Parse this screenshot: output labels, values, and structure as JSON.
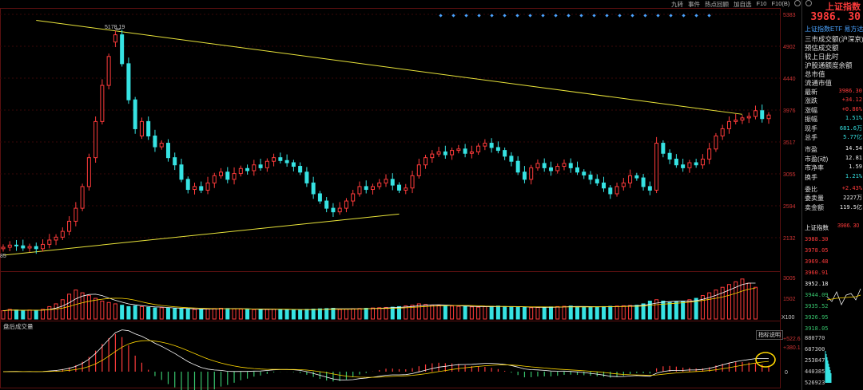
{
  "toolbar": {
    "items": [
      "九转",
      "事件",
      "热点回顾",
      "加自选",
      "F10",
      "F10(B)"
    ]
  },
  "header": {
    "index_name": "上证指数",
    "price": "3986. 30",
    "tab": "上证指数ETF 易方达"
  },
  "menu": [
    "三市成交额(沪深京)",
    "预估成交额",
    "较上日此时",
    "沪股通额度余额",
    "总市值",
    "流通市值"
  ],
  "stats": [
    {
      "k": "最新",
      "v": "3986.30",
      "c": "red"
    },
    {
      "k": "涨跌",
      "v": "+34.12",
      "c": "red"
    },
    {
      "k": "涨幅",
      "v": "+0.86%",
      "c": "red"
    },
    {
      "k": "振幅",
      "v": "1.51%",
      "c": "cyan"
    },
    {
      "k": "现手",
      "v": "681.6万",
      "c": "cyan"
    },
    {
      "k": "总手",
      "v": "5.77亿",
      "c": "cyan"
    },
    {
      "k": "市盈",
      "v": "14.54",
      "c": "white"
    },
    {
      "k": "市盈(动)",
      "v": "12.81",
      "c": "white"
    },
    {
      "k": "市净率",
      "v": "1.59",
      "c": "white"
    },
    {
      "k": "换手",
      "v": "1.21%",
      "c": "cyan"
    },
    {
      "k": "委比",
      "v": "+2.43%",
      "c": "red"
    },
    {
      "k": "委卖量",
      "v": "2227万",
      "c": "white"
    },
    {
      "k": "卖金额",
      "v": "119.5亿",
      "c": "white"
    }
  ],
  "mini": {
    "label": "上证指数",
    "value": "3986. 30"
  },
  "mini_scale": [
    "3988.30",
    "3978.05",
    "3969.48",
    "3960.91",
    "3952.18",
    "3944.09",
    "3935.52",
    "3926.95",
    "3918.05"
  ],
  "mini_volume": [
    "880770",
    "687300",
    "253847",
    "440385",
    "526923"
  ],
  "price_axis": [
    "5383",
    "4902",
    "4440",
    "3976",
    "3517",
    "3055",
    "2594",
    "2132"
  ],
  "peak_label": "5178.19",
  "low_label": "85",
  "volume_axis": [
    "3005",
    "1502",
    "X100"
  ],
  "volume_title": "盘后成交量",
  "indicator_axis": [
    "+522.6",
    "+380.1",
    "0"
  ],
  "indicator_btn": "指标说明",
  "chart_data": {
    "type": "candlestick",
    "y_axis": {
      "range": [
        2050,
        5383
      ],
      "ticks": [
        5383,
        4902,
        4440,
        3976,
        3517,
        3055,
        2594,
        2132
      ]
    },
    "annotations": [
      {
        "label": "5178.19",
        "value": 5178.19
      }
    ],
    "trendlines": [
      {
        "from": {
          "bar": 5,
          "value": 5300
        },
        "to": {
          "bar": 112,
          "value": 4000
        },
        "color": "#e8e33a"
      },
      {
        "from": {
          "bar": 0,
          "value": 2050
        },
        "to": {
          "bar": 60,
          "value": 2620
        },
        "color": "#e8e33a"
      }
    ],
    "closes": [
      2160,
      2190,
      2180,
      2150,
      2170,
      2140,
      2200,
      2260,
      2300,
      2380,
      2520,
      2700,
      3000,
      3400,
      3900,
      4400,
      4800,
      5100,
      4700,
      4200,
      3800,
      3900,
      3700,
      3550,
      3600,
      3400,
      3300,
      3100,
      2960,
      3000,
      2950,
      3050,
      3150,
      3200,
      3100,
      3180,
      3250,
      3220,
      3300,
      3260,
      3350,
      3400,
      3360,
      3330,
      3280,
      3200,
      3050,
      2900,
      2800,
      2700,
      2650,
      2700,
      2800,
      2900,
      3000,
      2960,
      3000,
      3050,
      3100,
      3020,
      2950,
      2980,
      3150,
      3300,
      3400,
      3450,
      3480,
      3440,
      3500,
      3520,
      3460,
      3480,
      3560,
      3600,
      3540,
      3500,
      3420,
      3350,
      3200,
      3100,
      3260,
      3320,
      3260,
      3220,
      3280,
      3320,
      3260,
      3200,
      3160,
      3100,
      3050,
      2980,
      2900,
      3000,
      3050,
      3150,
      3120,
      3000,
      2950,
      3600,
      3460,
      3380,
      3300,
      3260,
      3330,
      3300,
      3380,
      3520,
      3700,
      3800,
      3900,
      3920,
      3950,
      3970,
      4050,
      3940,
      3990
    ],
    "opens": [
      2140,
      2160,
      2190,
      2180,
      2150,
      2170,
      2140,
      2200,
      2260,
      2300,
      2380,
      2520,
      2700,
      3000,
      3400,
      3900,
      4400,
      5000,
      5100,
      4700,
      4200,
      3700,
      3900,
      3700,
      3550,
      3600,
      3400,
      3300,
      3100,
      2960,
      3000,
      2950,
      3050,
      3150,
      3200,
      3100,
      3180,
      3250,
      3220,
      3300,
      3260,
      3350,
      3400,
      3360,
      3330,
      3280,
      3200,
      3050,
      2900,
      2800,
      2700,
      2650,
      2700,
      2800,
      2900,
      3000,
      2960,
      3000,
      3050,
      3100,
      3020,
      2950,
      2980,
      3150,
      3300,
      3400,
      3450,
      3480,
      3440,
      3500,
      3520,
      3460,
      3480,
      3560,
      3600,
      3540,
      3500,
      3420,
      3350,
      3200,
      3100,
      3260,
      3320,
      3260,
      3220,
      3280,
      3320,
      3260,
      3200,
      3160,
      3100,
      3050,
      2980,
      2900,
      3000,
      3050,
      3150,
      3120,
      3000,
      2950,
      3600,
      3460,
      3380,
      3300,
      3260,
      3330,
      3300,
      3380,
      3520,
      3700,
      3800,
      3900,
      3920,
      3950,
      3970,
      4050,
      3940
    ],
    "volumes": [
      600,
      700,
      650,
      600,
      650,
      620,
      700,
      900,
      1100,
      1400,
      1800,
      2100,
      1900,
      1700,
      1500,
      1300,
      1200,
      1100,
      1000,
      900,
      950,
      900,
      850,
      800,
      820,
      780,
      760,
      740,
      720,
      700,
      720,
      740,
      760,
      780,
      760,
      740,
      720,
      700,
      690,
      680,
      700,
      720,
      700,
      680,
      660,
      640,
      700,
      720,
      740,
      760,
      780,
      700,
      720,
      740,
      760,
      780,
      800,
      820,
      840,
      860,
      900,
      950,
      1000,
      1100,
      1050,
      1000,
      980,
      960,
      940,
      920,
      900,
      880,
      860,
      900,
      920,
      940,
      900,
      880,
      860,
      840,
      820,
      840,
      860,
      880,
      900,
      920,
      940,
      900,
      880,
      860,
      880,
      900,
      920,
      940,
      960,
      980,
      1000,
      1100,
      1300,
      1400,
      1300,
      1200,
      1250,
      1300,
      1400,
      1500,
      1700,
      1900,
      2100,
      2300,
      2500,
      2700,
      2900,
      2600,
      2300
    ],
    "series_lines": [
      {
        "name": "",
        "color": "#ffffff"
      },
      {
        "name": "",
        "color": "#ffd700"
      }
    ]
  }
}
